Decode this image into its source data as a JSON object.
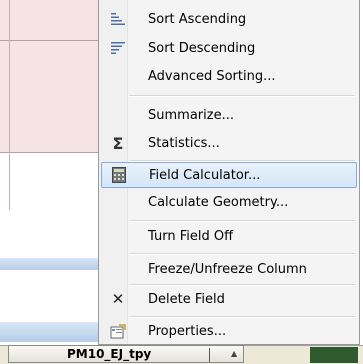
{
  "menu": {
    "items": [
      {
        "label": "Sort Ascending",
        "icon": "sort-ascending-icon"
      },
      {
        "label": "Sort Descending",
        "icon": "sort-descending-icon"
      },
      {
        "label": "Advanced Sorting...",
        "icon": ""
      },
      {
        "label": "Summarize...",
        "icon": ""
      },
      {
        "label": "Statistics...",
        "icon": "sigma-icon"
      },
      {
        "label": "Field Calculator...",
        "icon": "calculator-icon",
        "highlighted": true
      },
      {
        "label": "Calculate Geometry...",
        "icon": ""
      },
      {
        "label": "Turn Field Off",
        "icon": ""
      },
      {
        "label": "Freeze/Unfreeze Column",
        "icon": ""
      },
      {
        "label": "Delete Field",
        "icon": "delete-x-icon"
      },
      {
        "label": "Properties...",
        "icon": "properties-icon"
      }
    ]
  },
  "table": {
    "column_header": "PM10_EJ_tpy"
  },
  "colors": {
    "highlight": "#d4e6f8",
    "highlight_border": "#87acd8",
    "menu_bg": "#f4f4f4",
    "row_pink": "#f6e4e4"
  }
}
